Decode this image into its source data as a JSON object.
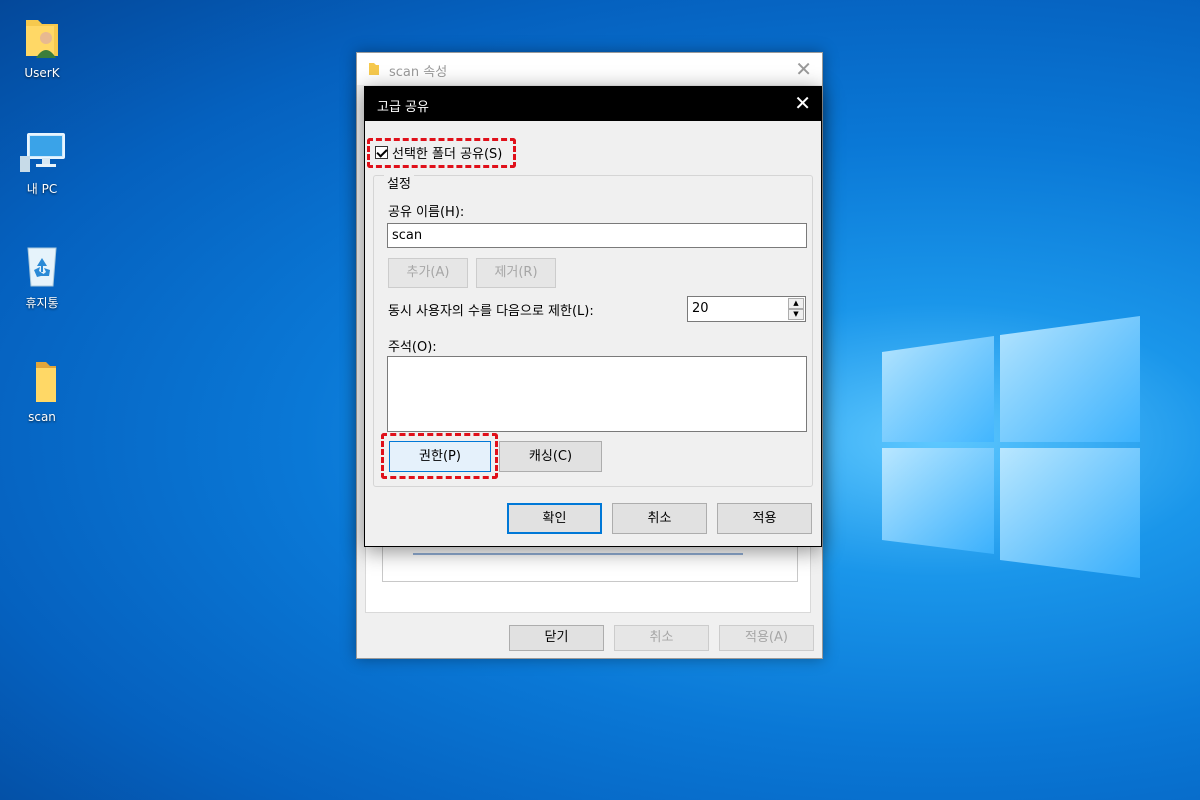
{
  "desktop": {
    "icons": [
      {
        "label": "UserK",
        "icon": "user-folder-icon"
      },
      {
        "label": "내 PC",
        "icon": "computer-icon"
      },
      {
        "label": "휴지통",
        "icon": "recycle-bin-icon"
      },
      {
        "label": "scan",
        "icon": "folder-icon"
      }
    ]
  },
  "properties_window": {
    "title": "scan 속성",
    "buttons": {
      "close": "닫기",
      "cancel": "취소",
      "apply": "적용(A)"
    }
  },
  "dialog": {
    "title": "고급 공유",
    "share_checkbox": {
      "label": "선택한 폴더 공유(S)",
      "checked": true
    },
    "settings_group": "설정",
    "share_name_label": "공유 이름(H):",
    "share_name_value": "scan",
    "add_button": "추가(A)",
    "remove_button": "제거(R)",
    "user_limit_label": "동시 사용자의 수를 다음으로 제한(L):",
    "user_limit_value": "20",
    "comment_label": "주석(O):",
    "comment_value": "",
    "permissions_button": "권한(P)",
    "caching_button": "캐싱(C)",
    "ok_button": "확인",
    "cancel_button": "취소",
    "apply_button": "적용"
  },
  "colors": {
    "highlight": "#e0101a",
    "focus": "#0078d7"
  }
}
